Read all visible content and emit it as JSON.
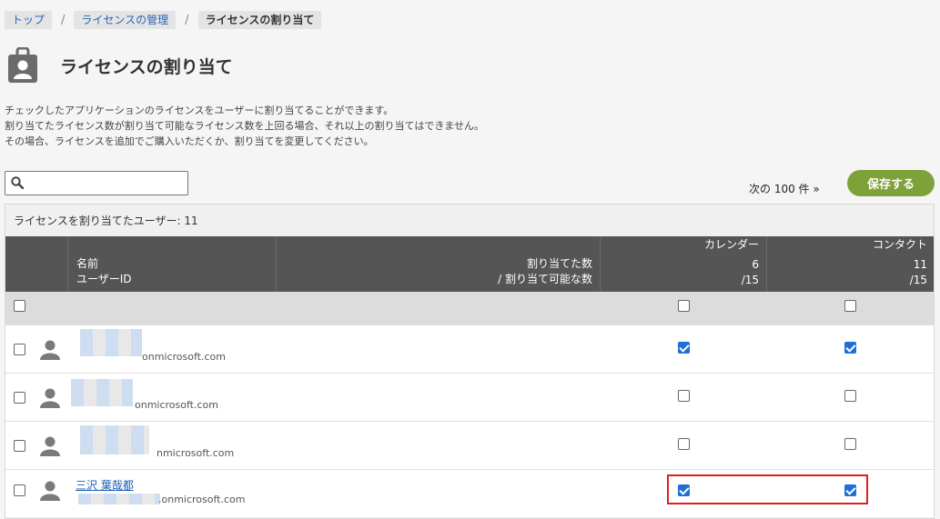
{
  "breadcrumb": {
    "top": "トップ",
    "manage": "ライセンスの管理",
    "current": "ライセンスの割り当て",
    "sep": "/"
  },
  "title": "ライセンスの割り当て",
  "description": [
    "チェックしたアプリケーションのライセンスをユーザーに割り当てることができます。",
    "割り当てたライセンス数が割り当て可能なライセンス数を上回る場合、それ以上の割り当てはできません。",
    "その場合、ライセンスを追加でご購入いただくか、割り当てを変更してください。"
  ],
  "search": {
    "placeholder": ""
  },
  "next_link": "次の 100 件 »",
  "save_label": "保存する",
  "assigned_count_text": "ライセンスを割り当てたユーザー: 11",
  "header": {
    "name": "名前",
    "user_id": "ユーザーID",
    "assigned": "割り当てた数",
    "assignable": "/ 割り当て可能な数",
    "apps": [
      {
        "name": "カレンダー",
        "used": "6",
        "total": "/15"
      },
      {
        "name": "コンタクト",
        "used": "11",
        "total": "/15"
      }
    ]
  },
  "rows": [
    {
      "name": "",
      "id": "onmicrosoft.com",
      "selected": false,
      "calendar": true,
      "contact": true
    },
    {
      "name": "",
      "id": "onmicrosoft.com",
      "selected": false,
      "calendar": false,
      "contact": false
    },
    {
      "name": "",
      "id": "nmicrosoft.com",
      "selected": false,
      "calendar": false,
      "contact": false
    },
    {
      "name": "三沢 葉哉都",
      "id": ".onmicrosoft.com",
      "selected": false,
      "calendar": true,
      "contact": true
    }
  ],
  "colors": {
    "accent": "#7ea13a",
    "header_bg": "#555555",
    "link": "#1a5fb4",
    "check": "#1f6fd6",
    "highlight": "#e0201e"
  }
}
